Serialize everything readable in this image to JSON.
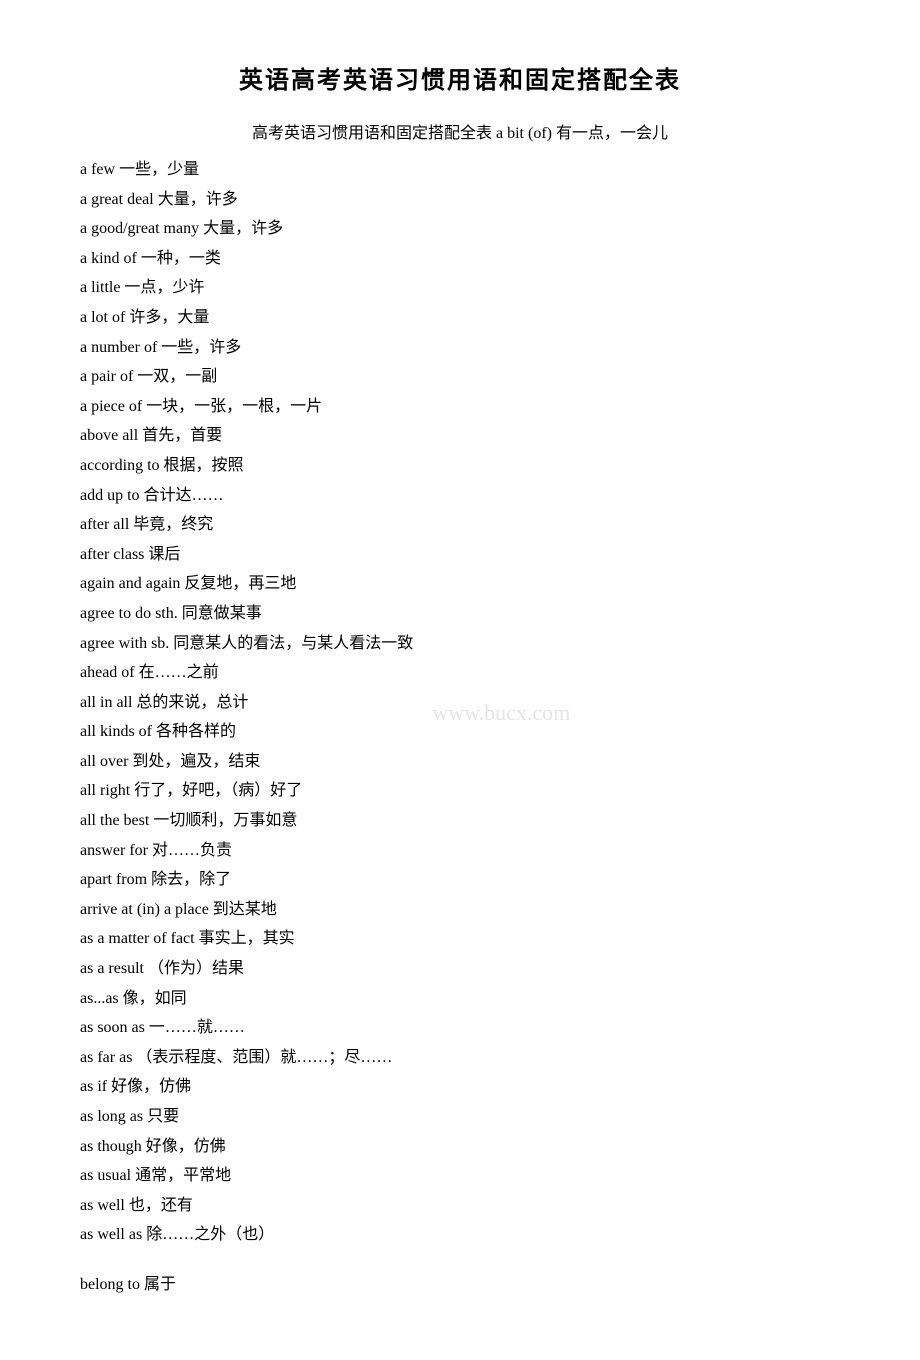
{
  "page": {
    "title": "英语高考英语习惯用语和固定搭配全表",
    "subtitle": "高考英语习惯用语和固定搭配全表 a bit (of) 有一点，一会儿",
    "entries": [
      "a few 一些，少量",
      "a great deal 大量，许多",
      "a good/great many 大量，许多",
      "a kind of 一种，一类",
      "a little 一点，少许",
      "a lot of 许多，大量",
      "a number of 一些，许多",
      "a pair of 一双，一副",
      "a piece of 一块，一张，一根，一片",
      "above all 首先，首要",
      "according to 根据，按照",
      "add up to 合计达……",
      "after all 毕竟，终究",
      "after class 课后",
      "again and again 反复地，再三地",
      "agree to do sth. 同意做某事",
      "agree with sb. 同意某人的看法，与某人看法一致",
      "ahead of 在……之前",
      "all in all 总的来说，总计",
      "all kinds of 各种各样的",
      "all over 到处，遍及，结束",
      "all right 行了，好吧，（病）好了",
      "all the best 一切顺利，万事如意",
      "answer for 对……负责",
      "apart from 除去，除了",
      "arrive at (in) a place 到达某地",
      "as a matter of fact 事实上，其实",
      "as a result （作为）结果",
      "as...as 像，如同",
      "as soon as 一……就……",
      "as far as （表示程度、范围）就……；尽……",
      "as if 好像，仿佛",
      "as long as 只要",
      "as though 好像，仿佛",
      "as usual 通常，平常地",
      "as well 也，还有",
      "as well as 除……之外（也）"
    ],
    "entries2": [
      "belong to 属于"
    ],
    "watermark": "www.bucx.com"
  }
}
